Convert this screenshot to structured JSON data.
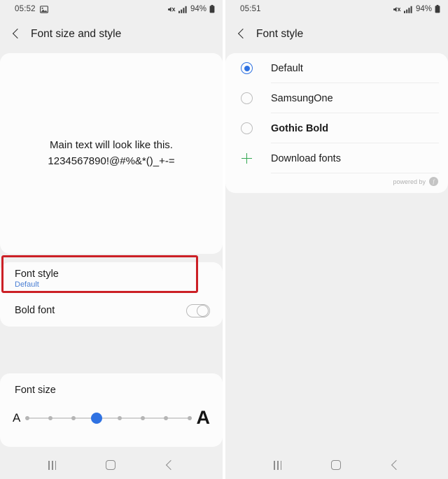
{
  "left": {
    "status": {
      "time": "05:52",
      "image_icon": "image-icon",
      "mute_icon": "sound-mute-icon",
      "signal_icon": "signal-bars-icon",
      "battery_text": "94%",
      "battery_icon": "battery-icon"
    },
    "title": "Font size and style",
    "back_icon": "back-chevron-icon",
    "preview": {
      "line1": "Main text will look like this.",
      "line2": "1234567890!@#%&*()_+-="
    },
    "font_style_row": {
      "title": "Font style",
      "value": "Default"
    },
    "bold_font_row": {
      "title": "Bold font",
      "toggle_state": "off"
    },
    "font_size": {
      "label": "Font size",
      "small_a": "A",
      "large_a": "A",
      "steps": 8,
      "selected_index": 3
    },
    "annotation": {
      "color": "#cc2026",
      "target": "font-style-row"
    },
    "nav": {
      "recents": "recents-icon",
      "home": "home-icon",
      "back": "back-icon"
    }
  },
  "right": {
    "status": {
      "time": "05:51",
      "mute_icon": "sound-mute-icon",
      "signal_icon": "signal-bars-icon",
      "battery_text": "94%",
      "battery_icon": "battery-icon"
    },
    "title": "Font style",
    "back_icon": "back-chevron-icon",
    "fonts": [
      {
        "label": "Default",
        "selected": true,
        "bold": false
      },
      {
        "label": "SamsungOne",
        "selected": false,
        "bold": false
      },
      {
        "label": "Gothic Bold",
        "selected": false,
        "bold": true
      }
    ],
    "download_row": {
      "label": "Download fonts",
      "icon": "plus-icon"
    },
    "powered": {
      "text": "powered by",
      "badge": "f"
    },
    "nav": {
      "recents": "recents-icon",
      "home": "home-icon",
      "back": "back-icon"
    }
  },
  "colors": {
    "accent_blue": "#2f72e2",
    "link_blue": "#4a7fd4",
    "annotation_red": "#cc2026",
    "green": "#34a853",
    "background": "#efefef",
    "card": "#fcfcfc"
  }
}
